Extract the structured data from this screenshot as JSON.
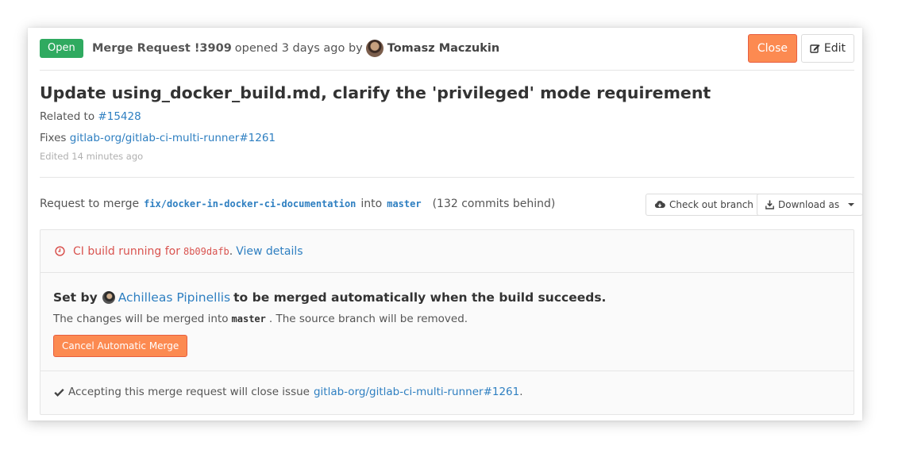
{
  "header": {
    "status": "Open",
    "mr_ref": "Merge Request !3909",
    "opened_text": "opened 3 days ago by",
    "author": "Tomasz Maczukin",
    "close_label": "Close",
    "edit_label": "Edit"
  },
  "title": "Update using_docker_build.md, clarify the 'privileged' mode requirement",
  "description": {
    "related_prefix": "Related to",
    "related_link": "#15428",
    "fixes_prefix": "Fixes",
    "fixes_link": "gitlab-org/gitlab-ci-multi-runner#1261",
    "edited": "Edited 14 minutes ago"
  },
  "branch_info": {
    "prefix": "Request to merge",
    "source_branch": "fix/docker-in-docker-ci-documentation",
    "into": "into",
    "target_branch": "master",
    "behind": "(132 commits behind)",
    "checkout_label": "Check out branch",
    "download_label": "Download as"
  },
  "widget": {
    "ci_prefix": "CI build running for",
    "ci_sha": "8b09dafb",
    "ci_dot": ".",
    "view_details": "View details",
    "set_by_prefix": "Set by",
    "set_by_user": "Achilleas Pipinellis",
    "set_by_suffix": "to be merged automatically when the build succeeds.",
    "changes_prefix": "The changes will be merged into",
    "changes_branch": "master",
    "changes_suffix": ". The source branch will be removed.",
    "cancel_label": "Cancel Automatic Merge",
    "closing_prefix": "Accepting this merge request will close issue",
    "closing_link": "gitlab-org/gitlab-ci-multi-runner#1261",
    "closing_suffix": "."
  },
  "colors": {
    "open_badge": "#2faa60",
    "close_button": "#fc8a51",
    "link": "#2e7fc1",
    "ci_running": "#d9534f"
  },
  "icons": {
    "edit": "pencil-square-icon",
    "checkout": "cloud-download-icon",
    "download": "download-icon",
    "ci_status": "clock-icon",
    "closing": "check-icon"
  }
}
